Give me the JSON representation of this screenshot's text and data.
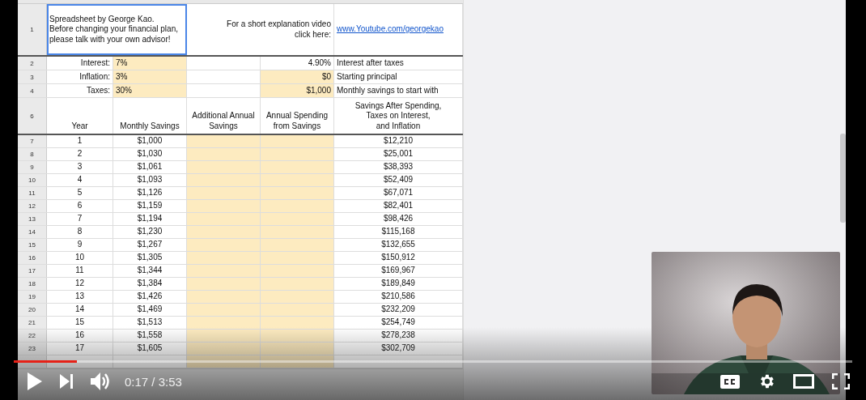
{
  "sheet": {
    "title_row": {
      "row_number": "1",
      "selected": true,
      "note_lines": [
        "Spreadsheet by George Kao.",
        "Before changing your financial plan,",
        "please talk with your own advisor!"
      ],
      "prompt_lines": [
        "For a short explanation video",
        "click here:"
      ],
      "link": "www.Youtube.com/georgekao"
    },
    "settings_rows": [
      {
        "row_number": "2",
        "label": "Interest:",
        "value": "7%",
        "result": "4.90%",
        "result_input": false,
        "result_label": "Interest after taxes"
      },
      {
        "row_number": "3",
        "label": "Inflation:",
        "value": "3%",
        "result": "$0",
        "result_input": true,
        "result_label": "Starting principal"
      },
      {
        "row_number": "4",
        "label": "Taxes:",
        "value": "30%",
        "result": "$1,000",
        "result_input": true,
        "result_label": "Monthly savings to start with"
      }
    ],
    "header_row": {
      "row_number": "6",
      "columns": [
        {
          "lines": [
            "Year"
          ],
          "input": false
        },
        {
          "lines": [
            "Monthly Savings"
          ],
          "input": false
        },
        {
          "lines": [
            "Additional Annual",
            "Savings"
          ],
          "input": false
        },
        {
          "lines": [
            "Annual Spending",
            "from Savings"
          ],
          "input": false
        },
        {
          "lines": [
            "Savings After Spending,",
            "Taxes on Interest,",
            "and Inflation"
          ],
          "input": false
        }
      ]
    },
    "rows": [
      {
        "row_number": "7",
        "year": "1",
        "monthly_savings": "$1,000",
        "savings_after": "$12,210"
      },
      {
        "row_number": "8",
        "year": "2",
        "monthly_savings": "$1,030",
        "savings_after": "$25,001"
      },
      {
        "row_number": "9",
        "year": "3",
        "monthly_savings": "$1,061",
        "savings_after": "$38,393"
      },
      {
        "row_number": "10",
        "year": "4",
        "monthly_savings": "$1,093",
        "savings_after": "$52,409"
      },
      {
        "row_number": "11",
        "year": "5",
        "monthly_savings": "$1,126",
        "savings_after": "$67,071"
      },
      {
        "row_number": "12",
        "year": "6",
        "monthly_savings": "$1,159",
        "savings_after": "$82,401"
      },
      {
        "row_number": "13",
        "year": "7",
        "monthly_savings": "$1,194",
        "savings_after": "$98,426"
      },
      {
        "row_number": "14",
        "year": "8",
        "monthly_savings": "$1,230",
        "savings_after": "$115,168"
      },
      {
        "row_number": "15",
        "year": "9",
        "monthly_savings": "$1,267",
        "savings_after": "$132,655"
      },
      {
        "row_number": "16",
        "year": "10",
        "monthly_savings": "$1,305",
        "savings_after": "$150,912"
      },
      {
        "row_number": "17",
        "year": "11",
        "monthly_savings": "$1,344",
        "savings_after": "$169,967"
      },
      {
        "row_number": "18",
        "year": "12",
        "monthly_savings": "$1,384",
        "savings_after": "$189,849"
      },
      {
        "row_number": "19",
        "year": "13",
        "monthly_savings": "$1,426",
        "savings_after": "$210,586"
      },
      {
        "row_number": "20",
        "year": "14",
        "monthly_savings": "$1,469",
        "savings_after": "$232,209"
      },
      {
        "row_number": "21",
        "year": "15",
        "monthly_savings": "$1,513",
        "savings_after": "$254,749"
      },
      {
        "row_number": "22",
        "year": "16",
        "monthly_savings": "$1,558",
        "savings_after": "$278,238"
      },
      {
        "row_number": "23",
        "year": "17",
        "monthly_savings": "$1,605",
        "savings_after": "$302,709"
      }
    ]
  },
  "player": {
    "progress": {
      "level": 0.075
    },
    "time": "0:17 / 3:53"
  }
}
